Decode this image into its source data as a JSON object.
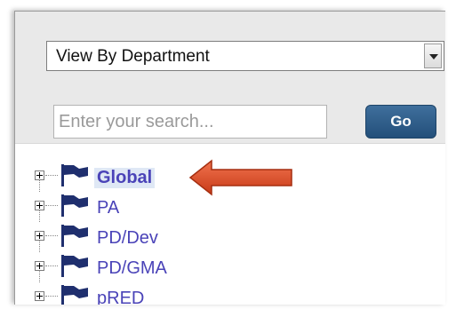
{
  "department_select": {
    "selected": "View By Department"
  },
  "search": {
    "placeholder": "Enter your search...",
    "go_label": "Go"
  },
  "tree": {
    "nodes": [
      {
        "label": "Global",
        "selected": true
      },
      {
        "label": "PA",
        "selected": false
      },
      {
        "label": "PD/Dev",
        "selected": false
      },
      {
        "label": "PD/GMA",
        "selected": false
      },
      {
        "label": "pRED",
        "selected": false
      }
    ]
  },
  "colors": {
    "link": "#4a43b8",
    "go_button": "#2c5a86",
    "arrow": "#e0502d",
    "flag": "#1f2f6e"
  },
  "icons": {
    "node_icon": "flag-icon",
    "expander_icon": "plus-expand-icon",
    "callout": "left-arrow-icon"
  }
}
